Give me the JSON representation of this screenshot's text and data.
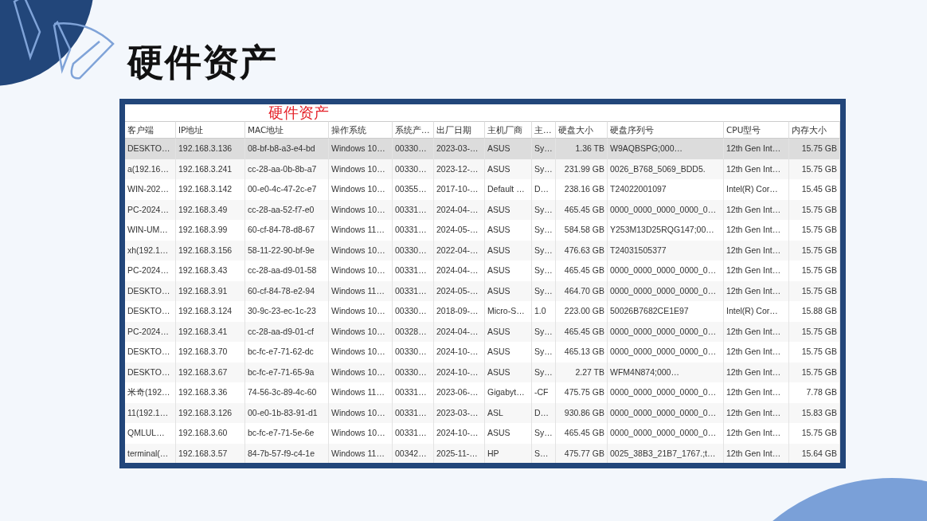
{
  "title": "硬件资产",
  "overlay_caption": "硬件资产",
  "table": {
    "columns": [
      "客户端",
      "IP地址",
      "MAC地址",
      "操作系统",
      "系统产…",
      "出厂日期",
      "主机厂商",
      "主…",
      "硬盘大小",
      "硬盘序列号",
      "CPU型号",
      "内存大小"
    ],
    "rows": [
      {
        "selected": true,
        "cells": [
          "DESKTO…",
          "192.168.3.136",
          "08-bf-b8-a3-e4-bd",
          "Windows 10…",
          "00330…",
          "2023-03-…",
          "ASUS",
          "Sy…",
          "1.36 TB",
          "W9AQBSPG;000…",
          "12th Gen Int…",
          "15.75 GB"
        ]
      },
      {
        "selected": false,
        "cells": [
          "a(192.16…",
          "192.168.3.241",
          "cc-28-aa-0b-8b-a7",
          "Windows 10…",
          "00330…",
          "2023-12-…",
          "ASUS",
          "Sy…",
          "231.99 GB",
          "0026_B768_5069_BDD5.",
          "12th Gen Int…",
          "15.75 GB"
        ]
      },
      {
        "selected": false,
        "cells": [
          "WIN-202…",
          "192.168.3.142",
          "00-e0-4c-47-2c-e7",
          "Windows 10…",
          "00355…",
          "2017-10-…",
          "Default …",
          "D…",
          "238.16 GB",
          "T24022001097",
          "Intel(R) Cor…",
          "15.45 GB"
        ]
      },
      {
        "selected": false,
        "cells": [
          "PC-2024…",
          "192.168.3.49",
          "cc-28-aa-52-f7-e0",
          "Windows 10…",
          "00331…",
          "2024-04-…",
          "ASUS",
          "Sy…",
          "465.45 GB",
          "0000_0000_0000_0000_0…",
          "12th Gen Int…",
          "15.75 GB"
        ]
      },
      {
        "selected": false,
        "cells": [
          "WIN-UM…",
          "192.168.3.99",
          "60-cf-84-78-d8-67",
          "Windows 11…",
          "00331…",
          "2024-05-…",
          "ASUS",
          "Sy…",
          "584.58 GB",
          "Y253M13D25RQG147;00…",
          "12th Gen Int…",
          "15.75 GB"
        ]
      },
      {
        "selected": false,
        "cells": [
          "xh(192.1…",
          "192.168.3.156",
          "58-11-22-90-bf-9e",
          "Windows 10…",
          "00330…",
          "2022-04-…",
          "ASUS",
          "Sy…",
          "476.63 GB",
          "T24031505377",
          "12th Gen Int…",
          "15.75 GB"
        ]
      },
      {
        "selected": false,
        "cells": [
          "PC-2024…",
          "192.168.3.43",
          "cc-28-aa-d9-01-58",
          "Windows 10…",
          "00331…",
          "2024-04-…",
          "ASUS",
          "Sy…",
          "465.45 GB",
          "0000_0000_0000_0000_0…",
          "12th Gen Int…",
          "15.75 GB"
        ]
      },
      {
        "selected": false,
        "cells": [
          "DESKTO…",
          "192.168.3.91",
          "60-cf-84-78-e2-94",
          "Windows 11…",
          "00331…",
          "2024-05-…",
          "ASUS",
          "Sy…",
          "464.70 GB",
          "0000_0000_0000_0000_0…",
          "12th Gen Int…",
          "15.75 GB"
        ]
      },
      {
        "selected": false,
        "cells": [
          "DESKTO…",
          "192.168.3.124",
          "30-9c-23-ec-1c-23",
          "Windows 10…",
          "00330…",
          "2018-09-…",
          "Micro-S…",
          "1.0",
          "223.00 GB",
          "50026B7682CE1E97",
          "Intel(R) Cor…",
          "15.88 GB"
        ]
      },
      {
        "selected": false,
        "cells": [
          "PC-2024…",
          "192.168.3.41",
          "cc-28-aa-d9-01-cf",
          "Windows 10…",
          "00328…",
          "2024-04-…",
          "ASUS",
          "Sy…",
          "465.45 GB",
          "0000_0000_0000_0000_0…",
          "12th Gen Int…",
          "15.75 GB"
        ]
      },
      {
        "selected": false,
        "cells": [
          "DESKTO…",
          "192.168.3.70",
          "bc-fc-e7-71-62-dc",
          "Windows 10…",
          "00330…",
          "2024-10-…",
          "ASUS",
          "Sy…",
          "465.13 GB",
          "0000_0000_0000_0000_0…",
          "12th Gen Int…",
          "15.75 GB"
        ]
      },
      {
        "selected": false,
        "cells": [
          "DESKTO…",
          "192.168.3.67",
          "bc-fc-e7-71-65-9a",
          "Windows 10…",
          "00330…",
          "2024-10-…",
          "ASUS",
          "Sy…",
          "2.27 TB",
          "WFM4N874;000…",
          "12th Gen Int…",
          "15.75 GB"
        ]
      },
      {
        "selected": false,
        "cells": [
          "米奇(192…",
          "192.168.3.36",
          "74-56-3c-89-4c-60",
          "Windows 11…",
          "00331…",
          "2023-06-…",
          "Gigabyt…",
          "-CF",
          "475.75 GB",
          "0000_0000_0000_0000_0…",
          "12th Gen Int…",
          "7.78 GB"
        ]
      },
      {
        "selected": false,
        "cells": [
          "11(192.1…",
          "192.168.3.126",
          "00-e0-1b-83-91-d1",
          "Windows 10…",
          "00331…",
          "2023-03-…",
          "ASL",
          "D…",
          "930.86 GB",
          "0000_0000_0000_0000_0…",
          "12th Gen Int…",
          "15.83 GB"
        ]
      },
      {
        "selected": false,
        "cells": [
          "QMLUL…",
          "192.168.3.60",
          "bc-fc-e7-71-5e-6e",
          "Windows 10…",
          "00331…",
          "2024-10-…",
          "ASUS",
          "Sy…",
          "465.45 GB",
          "0000_0000_0000_0000_0…",
          "12th Gen Int…",
          "15.75 GB"
        ]
      },
      {
        "selected": false,
        "cells": [
          "terminal(…",
          "192.168.3.57",
          "84-7b-57-f9-c4-1e",
          "Windows 11…",
          "00342…",
          "2025-11-…",
          "HP",
          "S…",
          "475.77 GB",
          "0025_38B3_21B7_1767.;t…",
          "12th Gen Int…",
          "15.64 GB"
        ]
      }
    ]
  }
}
